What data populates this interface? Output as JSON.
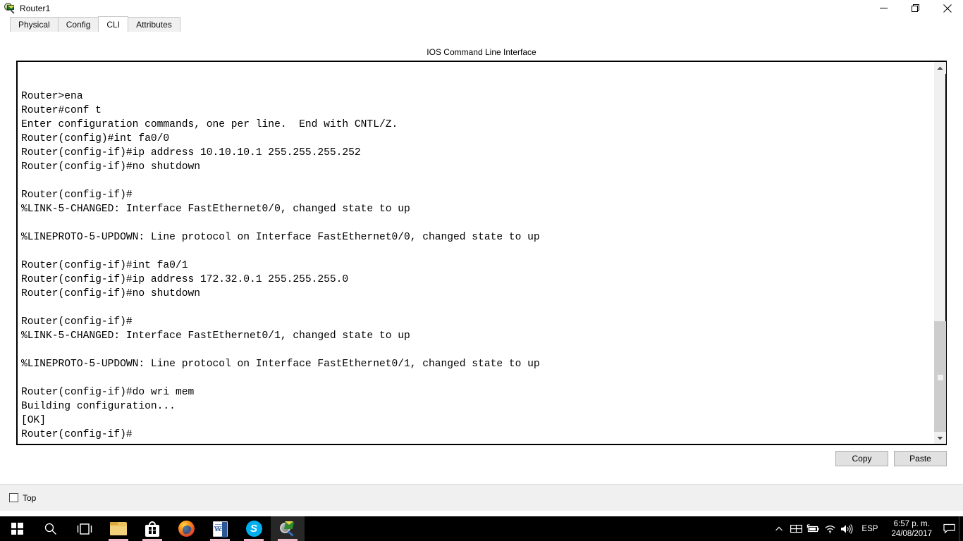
{
  "window": {
    "title": "Router1",
    "icon": "packet-tracer-icon",
    "controls": {
      "minimize": "minimize-icon",
      "maximize": "restore-icon",
      "close": "close-icon"
    }
  },
  "tabs": [
    {
      "label": "Physical",
      "active": false
    },
    {
      "label": "Config",
      "active": false
    },
    {
      "label": "CLI",
      "active": true
    },
    {
      "label": "Attributes",
      "active": false
    }
  ],
  "cli": {
    "heading": "IOS Command Line Interface",
    "terminal_text": "\nRouter>ena\nRouter#conf t\nEnter configuration commands, one per line.  End with CNTL/Z.\nRouter(config)#int fa0/0\nRouter(config-if)#ip address 10.10.10.1 255.255.255.252\nRouter(config-if)#no shutdown\n\nRouter(config-if)#\n%LINK-5-CHANGED: Interface FastEthernet0/0, changed state to up\n\n%LINEPROTO-5-UPDOWN: Line protocol on Interface FastEthernet0/0, changed state to up\n\nRouter(config-if)#int fa0/1\nRouter(config-if)#ip address 172.32.0.1 255.255.255.0\nRouter(config-if)#no shutdown\n\nRouter(config-if)#\n%LINK-5-CHANGED: Interface FastEthernet0/1, changed state to up\n\n%LINEPROTO-5-UPDOWN: Line protocol on Interface FastEthernet0/1, changed state to up\n\nRouter(config-if)#do wri mem\nBuilding configuration...\n[OK]\nRouter(config-if)#",
    "scrollbar": {
      "up_arrow": "scroll-up-arrow-icon",
      "down_arrow": "scroll-down-arrow-icon"
    },
    "copy_label": "Copy",
    "paste_label": "Paste"
  },
  "bottom": {
    "top_checkbox_label": "Top",
    "top_checkbox_checked": false
  },
  "taskbar": {
    "items": [
      {
        "name": "start-button",
        "icon": "windows-logo-icon",
        "running": false
      },
      {
        "name": "search-button",
        "icon": "search-icon",
        "running": false
      },
      {
        "name": "task-view-button",
        "icon": "task-view-icon",
        "running": false
      },
      {
        "name": "file-explorer",
        "icon": "folder-icon",
        "running": true
      },
      {
        "name": "microsoft-store",
        "icon": "store-bag-icon",
        "running": true
      },
      {
        "name": "firefox",
        "icon": "firefox-icon",
        "running": false
      },
      {
        "name": "microsoft-word",
        "icon": "word-icon",
        "running": true
      },
      {
        "name": "skype",
        "icon": "skype-icon",
        "running": true
      },
      {
        "name": "packet-tracer",
        "icon": "packet-tracer-icon",
        "running": true
      }
    ],
    "tray": {
      "overflow": "chevron-up-icon",
      "icons": [
        {
          "name": "display-icon"
        },
        {
          "name": "battery-icon"
        },
        {
          "name": "wifi-icon"
        },
        {
          "name": "volume-icon"
        }
      ],
      "language": "ESP",
      "time": "6:57 p. m.",
      "date": "24/08/2017",
      "action_center": "action-center-icon"
    }
  },
  "colors": {
    "taskbar_bg": "#000000",
    "window_bg": "#ffffff",
    "panel_bg": "#f0f0f0",
    "terminal_border": "#000000",
    "running_indicator": "#f0b9c6",
    "accent": "#0078d7"
  }
}
